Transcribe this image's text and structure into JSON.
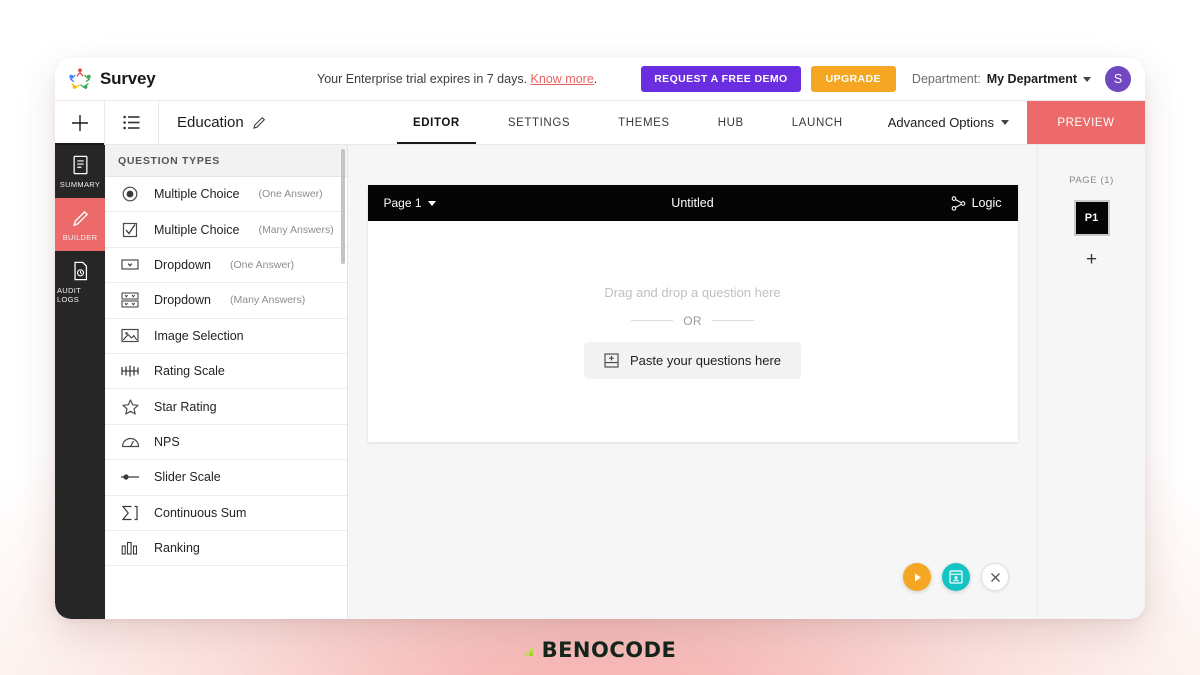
{
  "app": {
    "brand_name": "Survey",
    "logo_icon": "survey-star-people-icon",
    "trial_text": "Your Enterprise trial expires in 7 days.",
    "trial_link": "Know more",
    "trial_period": ".",
    "demo_button": "REQUEST A FREE DEMO",
    "upgrade_button": "UPGRADE",
    "department_label": "Department:",
    "department_value": "My Department",
    "avatar_initial": "S"
  },
  "nav": {
    "add_icon": "plus-icon",
    "list_icon": "list-menu-icon",
    "survey_title": "Education",
    "edit_icon": "pencil-icon",
    "tabs": [
      {
        "label": "EDITOR",
        "active": true
      },
      {
        "label": "SETTINGS",
        "active": false
      },
      {
        "label": "THEMES",
        "active": false
      },
      {
        "label": "HUB",
        "active": false
      },
      {
        "label": "LAUNCH",
        "active": false
      }
    ],
    "advanced_options": "Advanced Options",
    "preview_button": "PREVIEW"
  },
  "rail": {
    "items": [
      {
        "label": "SUMMARY",
        "icon": "document-summary-icon",
        "active": false
      },
      {
        "label": "BUILDER",
        "icon": "pencil-icon",
        "active": true
      },
      {
        "label": "AUDIT LOGS",
        "icon": "file-clock-icon",
        "active": false
      }
    ]
  },
  "question_panel": {
    "header": "QUESTION TYPES",
    "items": [
      {
        "label": "Multiple Choice",
        "sub": "(One Answer)",
        "icon": "radio-button-icon"
      },
      {
        "label": "Multiple Choice",
        "sub": "(Many Answers)",
        "icon": "checkbox-icon"
      },
      {
        "label": "Dropdown",
        "sub": "(One Answer)",
        "icon": "dropdown-icon"
      },
      {
        "label": "Dropdown",
        "sub": "(Many Answers)",
        "icon": "multi-dropdown-icon"
      },
      {
        "label": "Image Selection",
        "sub": "",
        "icon": "image-icon"
      },
      {
        "label": "Rating Scale",
        "sub": "",
        "icon": "rating-scale-icon"
      },
      {
        "label": "Star Rating",
        "sub": "",
        "icon": "star-icon"
      },
      {
        "label": "NPS",
        "sub": "",
        "icon": "gauge-icon"
      },
      {
        "label": "Slider Scale",
        "sub": "",
        "icon": "slider-icon"
      },
      {
        "label": "Continuous Sum",
        "sub": "",
        "icon": "sigma-icon"
      },
      {
        "label": "Ranking",
        "sub": "",
        "icon": "bar-ranking-icon"
      }
    ]
  },
  "canvas": {
    "page_selector": "Page 1",
    "card_title": "Untitled",
    "logic_label": "Logic",
    "logic_icon": "logic-branch-icon",
    "drop_text": "Drag and drop a question here",
    "or_text": "OR",
    "paste_text": "Paste your questions here",
    "paste_icon": "paste-box-icon",
    "fabs": [
      {
        "name": "play",
        "icon": "play-icon",
        "color": "#f5a623"
      },
      {
        "name": "preview-device",
        "icon": "device-preview-icon",
        "color": "#14c3c3"
      },
      {
        "name": "close",
        "icon": "close-x-icon",
        "color": "#ffffff"
      }
    ]
  },
  "pages_panel": {
    "title": "PAGE (1)",
    "pages": [
      {
        "label": "P1"
      }
    ],
    "add_icon": "plus-icon"
  },
  "footer": {
    "logo_text": "BENOCODE",
    "logo_mark": "benocode-dots-icon"
  },
  "colors": {
    "accent_red": "#ec6a6a",
    "purple": "#6a2ee0",
    "orange": "#f5a623",
    "teal": "#14c3c3",
    "dark": "#262626"
  }
}
